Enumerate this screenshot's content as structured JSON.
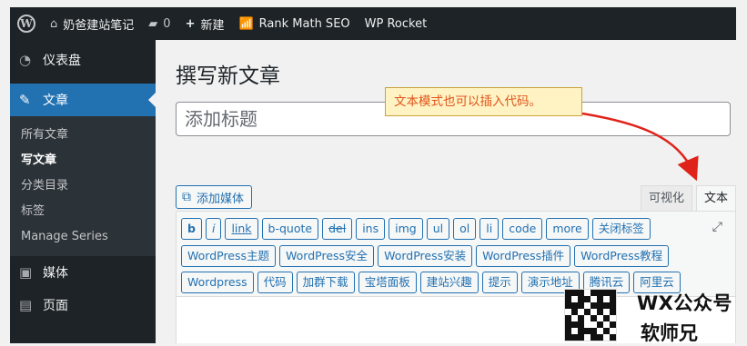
{
  "adminbar": {
    "site_name": "奶爸建站笔记",
    "comments_count": "0",
    "new_label": "新建",
    "rankmath_label": "Rank Math SEO",
    "wprocket_label": "WP Rocket"
  },
  "sidebar": {
    "dashboard": "仪表盘",
    "posts": "文章",
    "submenu": [
      "所有文章",
      "写文章",
      "分类目录",
      "标签",
      "Manage Series"
    ],
    "media": "媒体",
    "pages": "页面"
  },
  "editor": {
    "page_title": "撰写新文章",
    "title_placeholder": "添加标题",
    "add_media": "添加媒体",
    "tab_visual": "可视化",
    "tab_text": "文本",
    "row1": [
      "b",
      "i",
      "link",
      "b-quote",
      "del",
      "ins",
      "img",
      "ul",
      "ol",
      "li",
      "code",
      "more",
      "关闭标签"
    ],
    "row2": [
      "WordPress主题",
      "WordPress安全",
      "WordPress安装",
      "WordPress插件",
      "WordPress教程"
    ],
    "row3": [
      "Wordpress",
      "代码",
      "加群下载",
      "宝塔面板",
      "建站兴趣",
      "提示",
      "演示地址",
      "腾讯云",
      "阿里云"
    ]
  },
  "annotation": {
    "text": "文本模式也可以插入代码。"
  },
  "watermark": {
    "line1": "WX公众号",
    "line2": "软师兄"
  },
  "colors": {
    "accent": "#2271b1",
    "adminbar": "#1d2327",
    "arrow": "#e0231a",
    "note_bg": "#fff3c4"
  }
}
